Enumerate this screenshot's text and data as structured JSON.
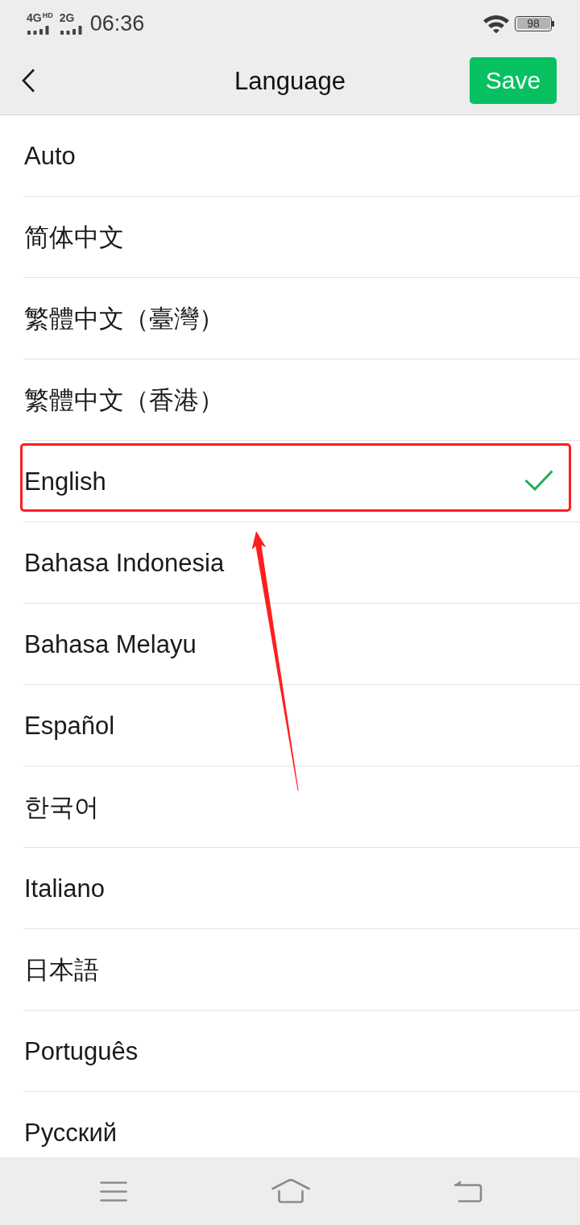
{
  "status_bar": {
    "signals": [
      {
        "label": "4G",
        "badge": "HD"
      },
      {
        "label": "2G"
      }
    ],
    "time": "06:36",
    "battery": "98"
  },
  "header": {
    "title": "Language",
    "save_button": "Save"
  },
  "languages": [
    {
      "label": "Auto",
      "selected": false,
      "highlighted": false
    },
    {
      "label": "简体中文",
      "selected": false,
      "highlighted": false
    },
    {
      "label": "繁體中文（臺灣）",
      "selected": false,
      "highlighted": false
    },
    {
      "label": "繁體中文（香港）",
      "selected": false,
      "highlighted": false
    },
    {
      "label": "English",
      "selected": true,
      "highlighted": true
    },
    {
      "label": "Bahasa Indonesia",
      "selected": false,
      "highlighted": false
    },
    {
      "label": "Bahasa Melayu",
      "selected": false,
      "highlighted": false
    },
    {
      "label": "Español",
      "selected": false,
      "highlighted": false
    },
    {
      "label": "한국어",
      "selected": false,
      "highlighted": false
    },
    {
      "label": "Italiano",
      "selected": false,
      "highlighted": false
    },
    {
      "label": "日本語",
      "selected": false,
      "highlighted": false
    },
    {
      "label": "Português",
      "selected": false,
      "highlighted": false
    },
    {
      "label": "Русский",
      "selected": false,
      "highlighted": false
    }
  ]
}
